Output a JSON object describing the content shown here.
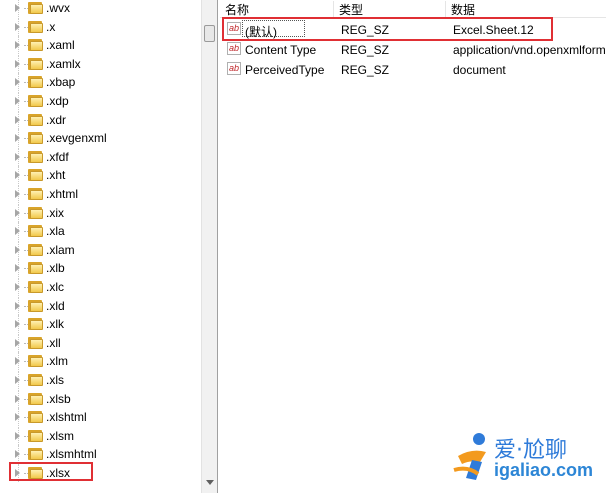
{
  "tree": {
    "items": [
      ".wvx",
      ".x",
      ".xaml",
      ".xamlx",
      ".xbap",
      ".xdp",
      ".xdr",
      ".xevgenxml",
      ".xfdf",
      ".xht",
      ".xhtml",
      ".xix",
      ".xla",
      ".xlam",
      ".xlb",
      ".xlc",
      ".xld",
      ".xlk",
      ".xll",
      ".xlm",
      ".xls",
      ".xlsb",
      ".xlshtml",
      ".xlsm",
      ".xlsmhtml",
      ".xlsx"
    ],
    "selected": ".xlsx"
  },
  "values": {
    "columns": {
      "name": "名称",
      "type": "类型",
      "data": "数据"
    },
    "icon_text": "ab",
    "rows": [
      {
        "name": "(默认)",
        "type": "REG_SZ",
        "data": "Excel.Sheet.12"
      },
      {
        "name": "Content Type",
        "type": "REG_SZ",
        "data": "application/vnd.openxmlforma"
      },
      {
        "name": "PerceivedType",
        "type": "REG_SZ",
        "data": "document"
      }
    ]
  },
  "watermark": {
    "text": "爱·尬聊",
    "domain": "igaliao.com"
  },
  "colors": {
    "highlight": "#e02f34",
    "folder": "#f1c84b",
    "watermark": "#2f7bd9"
  }
}
